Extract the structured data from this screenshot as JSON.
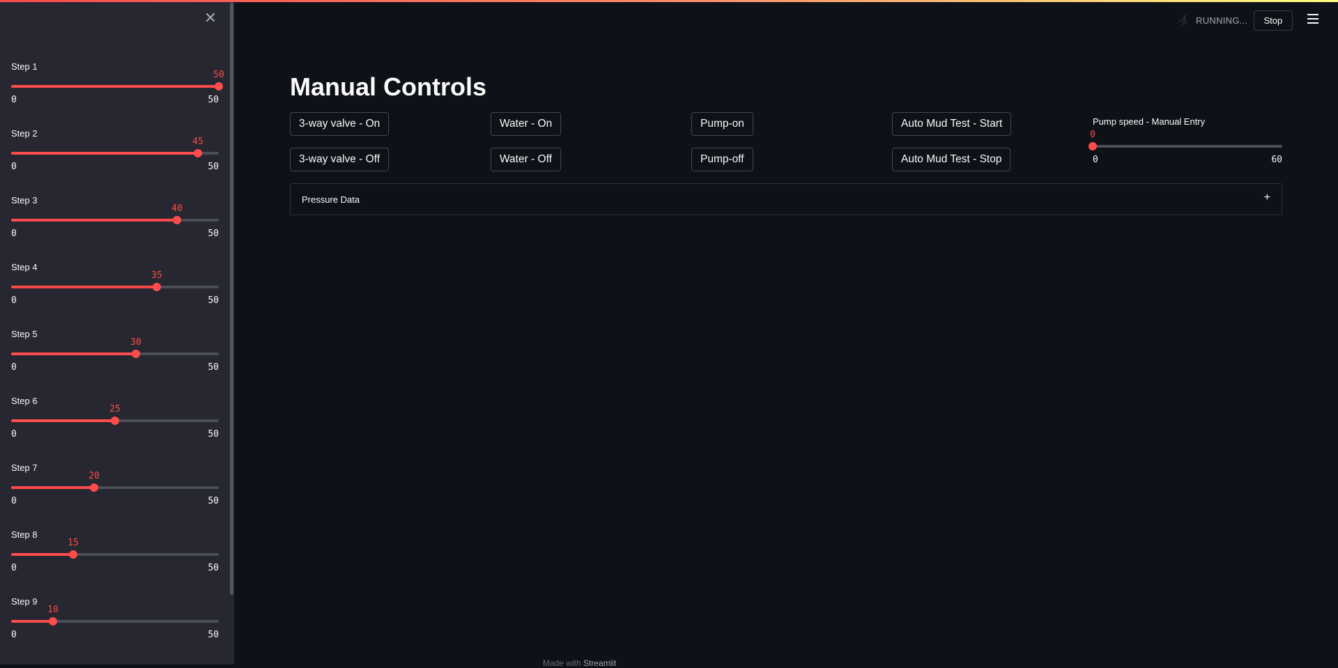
{
  "sidebar": {
    "close_label": "✕",
    "sliders": [
      {
        "label": "Step 1",
        "value": 50,
        "min": 0,
        "max": 50
      },
      {
        "label": "Step 2",
        "value": 45,
        "min": 0,
        "max": 50
      },
      {
        "label": "Step 3",
        "value": 40,
        "min": 0,
        "max": 50
      },
      {
        "label": "Step 4",
        "value": 35,
        "min": 0,
        "max": 50
      },
      {
        "label": "Step 5",
        "value": 30,
        "min": 0,
        "max": 50
      },
      {
        "label": "Step 6",
        "value": 25,
        "min": 0,
        "max": 50
      },
      {
        "label": "Step 7",
        "value": 20,
        "min": 0,
        "max": 50
      },
      {
        "label": "Step 8",
        "value": 15,
        "min": 0,
        "max": 50
      },
      {
        "label": "Step 9",
        "value": 10,
        "min": 0,
        "max": 50
      }
    ]
  },
  "header": {
    "status_text": "RUNNING...",
    "stop_label": "Stop",
    "running_icon": "running-person-icon",
    "menu_icon": "hamburger-menu-icon"
  },
  "main": {
    "title": "Manual Controls",
    "buttons": {
      "valve_on": "3-way valve - On",
      "valve_off": "3-way valve - Off",
      "water_on": "Water - On",
      "water_off": "Water - Off",
      "pump_on": "Pump-on",
      "pump_off": "Pump-off",
      "mud_start": "Auto Mud Test - Start",
      "mud_stop": "Auto Mud Test - Stop"
    },
    "pump_speed": {
      "label": "Pump speed - Manual Entry",
      "value": 0,
      "min": 0,
      "max": 60
    },
    "expander": {
      "label": "Pressure Data",
      "icon": "+"
    }
  },
  "footer": {
    "prefix": "Made with ",
    "brand": "Streamlit"
  },
  "colors": {
    "accent": "#ff4b4b",
    "background": "#0e1117",
    "sidebar": "#262730"
  }
}
